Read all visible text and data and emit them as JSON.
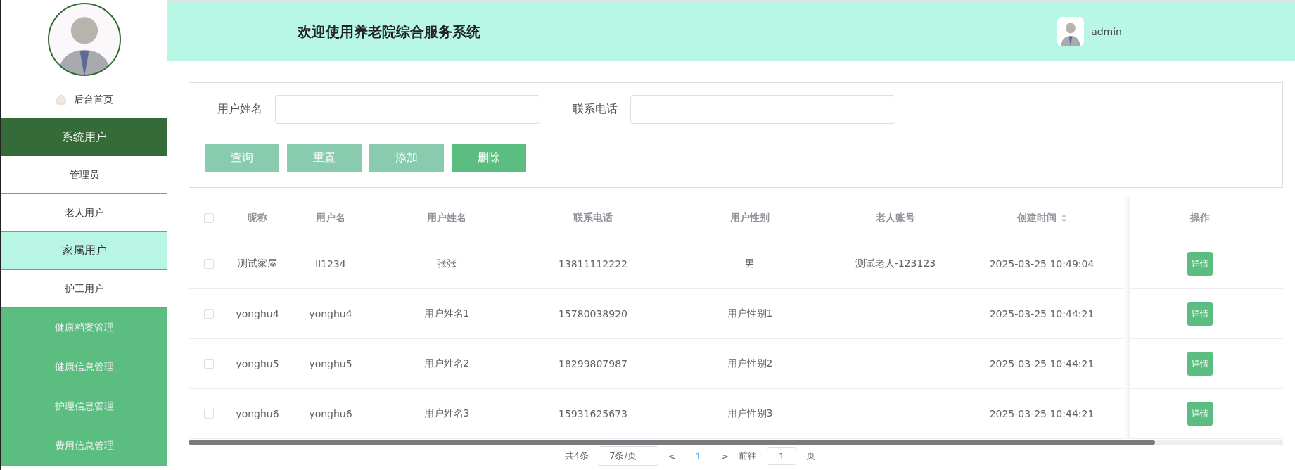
{
  "sidebar": {
    "home": "后台首页",
    "items": [
      {
        "label": "系统用户",
        "kind": "group",
        "selected": false
      },
      {
        "label": "管理员",
        "kind": "sub",
        "selected": false
      },
      {
        "label": "老人用户",
        "kind": "sub",
        "selected": false
      },
      {
        "label": "家属用户",
        "kind": "sub",
        "selected": true
      },
      {
        "label": "护工用户",
        "kind": "sub",
        "selected": false
      },
      {
        "label": "健康档案管理",
        "kind": "menu",
        "selected": false
      },
      {
        "label": "健康信息管理",
        "kind": "menu",
        "selected": false
      },
      {
        "label": "护理信息管理",
        "kind": "menu",
        "selected": false
      },
      {
        "label": "费用信息管理",
        "kind": "menu",
        "selected": false
      }
    ]
  },
  "header": {
    "title": "欢迎使用养老院综合服务系统",
    "user": "admin"
  },
  "search": {
    "fields": [
      {
        "label": "用户姓名"
      },
      {
        "label": "联系电话"
      }
    ],
    "buttons": [
      {
        "label": "查询",
        "color": "#88cbaf"
      },
      {
        "label": "重置",
        "color": "#88cbaf"
      },
      {
        "label": "添加",
        "color": "#88cbaf"
      },
      {
        "label": "删除",
        "color": "#5bbd80"
      }
    ]
  },
  "table": {
    "select_all": {
      "checked": false
    },
    "columns": [
      {
        "label": "昵称",
        "sortable": false
      },
      {
        "label": "用户名",
        "sortable": false
      },
      {
        "label": "用户姓名",
        "sortable": false
      },
      {
        "label": "联系电话",
        "sortable": false
      },
      {
        "label": "用户性别",
        "sortable": false
      },
      {
        "label": "老人账号",
        "sortable": false
      },
      {
        "label": "创建时间",
        "sortable": true
      },
      {
        "label": "操作",
        "sortable": false
      }
    ],
    "rows": [
      {
        "checked": false,
        "cells": [
          "测试家屋",
          "ll1234",
          "张张",
          "13811112222",
          "男",
          "测试老人-123123",
          "2025-03-25 10:49:04"
        ],
        "action": "详情"
      },
      {
        "checked": false,
        "cells": [
          "yonghu4",
          "yonghu4",
          "用户姓名1",
          "15780038920",
          "用户性别1",
          "",
          "2025-03-25 10:44:21"
        ],
        "action": "详情"
      },
      {
        "checked": false,
        "cells": [
          "yonghu5",
          "yonghu5",
          "用户姓名2",
          "18299807987",
          "用户性别2",
          "",
          "2025-03-25 10:44:21"
        ],
        "action": "详情"
      },
      {
        "checked": false,
        "cells": [
          "yonghu6",
          "yonghu6",
          "用户姓名3",
          "15931625673",
          "用户性别3",
          "",
          "2025-03-25 10:44:21"
        ],
        "action": "详情"
      }
    ]
  },
  "pagination": {
    "total": "共4条",
    "page_size": "7条/页",
    "prev": "<",
    "pages": [
      {
        "label": "1",
        "selected": true
      }
    ],
    "next": ">",
    "goto": "前往",
    "goto_value": "1",
    "page_unit": "页"
  }
}
